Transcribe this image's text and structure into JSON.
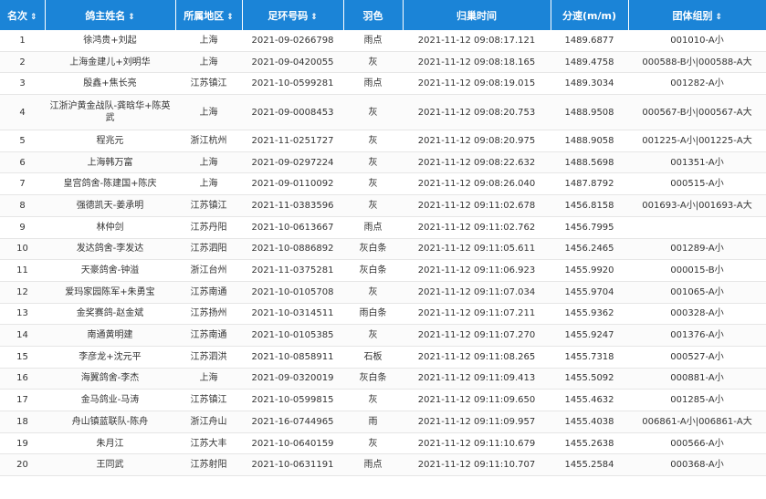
{
  "columns": [
    {
      "label": "名次",
      "sortable": true
    },
    {
      "label": "鸽主姓名",
      "sortable": true
    },
    {
      "label": "所属地区",
      "sortable": true
    },
    {
      "label": "足环号码",
      "sortable": true
    },
    {
      "label": "羽色",
      "sortable": false
    },
    {
      "label": "归巢时间",
      "sortable": false
    },
    {
      "label": "分速(m/m)",
      "sortable": false
    },
    {
      "label": "团体组别",
      "sortable": true
    }
  ],
  "sort_icon": "⇕",
  "rows": [
    [
      "1",
      "徐鸿贵+刘起",
      "上海",
      "2021-09-0266798",
      "雨点",
      "2021-11-12 09:08:17.121",
      "1489.6877",
      "001010-A小"
    ],
    [
      "2",
      "上海金建儿+刘明华",
      "上海",
      "2021-09-0420055",
      "灰",
      "2021-11-12 09:08:18.165",
      "1489.4758",
      "000588-B小|000588-A大"
    ],
    [
      "3",
      "殷鑫+焦长亮",
      "江苏镇江",
      "2021-10-0599281",
      "雨点",
      "2021-11-12 09:08:19.015",
      "1489.3034",
      "001282-A小"
    ],
    [
      "4",
      "江浙沪黄金战队-龚晗华+陈英武",
      "上海",
      "2021-09-0008453",
      "灰",
      "2021-11-12 09:08:20.753",
      "1488.9508",
      "000567-B小|000567-A大"
    ],
    [
      "5",
      "程兆元",
      "浙江杭州",
      "2021-11-0251727",
      "灰",
      "2021-11-12 09:08:20.975",
      "1488.9058",
      "001225-A小|001225-A大"
    ],
    [
      "6",
      "上海韩万富",
      "上海",
      "2021-09-0297224",
      "灰",
      "2021-11-12 09:08:22.632",
      "1488.5698",
      "001351-A小"
    ],
    [
      "7",
      "皇宫鸽舍-陈建国+陈庆",
      "上海",
      "2021-09-0110092",
      "灰",
      "2021-11-12 09:08:26.040",
      "1487.8792",
      "000515-A小"
    ],
    [
      "8",
      "强德凯天-姜承明",
      "江苏镇江",
      "2021-11-0383596",
      "灰",
      "2021-11-12 09:11:02.678",
      "1456.8158",
      "001693-A小|001693-A大"
    ],
    [
      "9",
      "林仲剑",
      "江苏丹阳",
      "2021-10-0613667",
      "雨点",
      "2021-11-12 09:11:02.762",
      "1456.7995",
      ""
    ],
    [
      "10",
      "发达鸽舍-李发达",
      "江苏泗阳",
      "2021-10-0886892",
      "灰白条",
      "2021-11-12 09:11:05.611",
      "1456.2465",
      "001289-A小"
    ],
    [
      "11",
      "天豪鸽舍-钟溢",
      "浙江台州",
      "2021-11-0375281",
      "灰白条",
      "2021-11-12 09:11:06.923",
      "1455.9920",
      "000015-B小"
    ],
    [
      "12",
      "爱玛家园陈军+朱勇宝",
      "江苏南通",
      "2021-10-0105708",
      "灰",
      "2021-11-12 09:11:07.034",
      "1455.9704",
      "001065-A小"
    ],
    [
      "13",
      "金奖赛鸽-赵金斌",
      "江苏扬州",
      "2021-10-0314511",
      "雨白条",
      "2021-11-12 09:11:07.211",
      "1455.9362",
      "000328-A小"
    ],
    [
      "14",
      "南通黄明建",
      "江苏南通",
      "2021-10-0105385",
      "灰",
      "2021-11-12 09:11:07.270",
      "1455.9247",
      "001376-A小"
    ],
    [
      "15",
      "李彦龙+沈元平",
      "江苏泗洪",
      "2021-10-0858911",
      "石板",
      "2021-11-12 09:11:08.265",
      "1455.7318",
      "000527-A小"
    ],
    [
      "16",
      "海翼鸽舍-李杰",
      "上海",
      "2021-09-0320019",
      "灰白条",
      "2021-11-12 09:11:09.413",
      "1455.5092",
      "000881-A小"
    ],
    [
      "17",
      "金马鸽业-马涛",
      "江苏镇江",
      "2021-10-0599815",
      "灰",
      "2021-11-12 09:11:09.650",
      "1455.4632",
      "001285-A小"
    ],
    [
      "18",
      "舟山镇蓝联队-陈舟",
      "浙江舟山",
      "2021-16-0744965",
      "雨",
      "2021-11-12 09:11:09.957",
      "1455.4038",
      "006861-A小|006861-A大"
    ],
    [
      "19",
      "朱月江",
      "江苏大丰",
      "2021-10-0640159",
      "灰",
      "2021-11-12 09:11:10.679",
      "1455.2638",
      "000566-A小"
    ],
    [
      "20",
      "王同武",
      "江苏射阳",
      "2021-10-0631191",
      "雨点",
      "2021-11-12 09:11:10.707",
      "1455.2584",
      "000368-A小"
    ]
  ]
}
